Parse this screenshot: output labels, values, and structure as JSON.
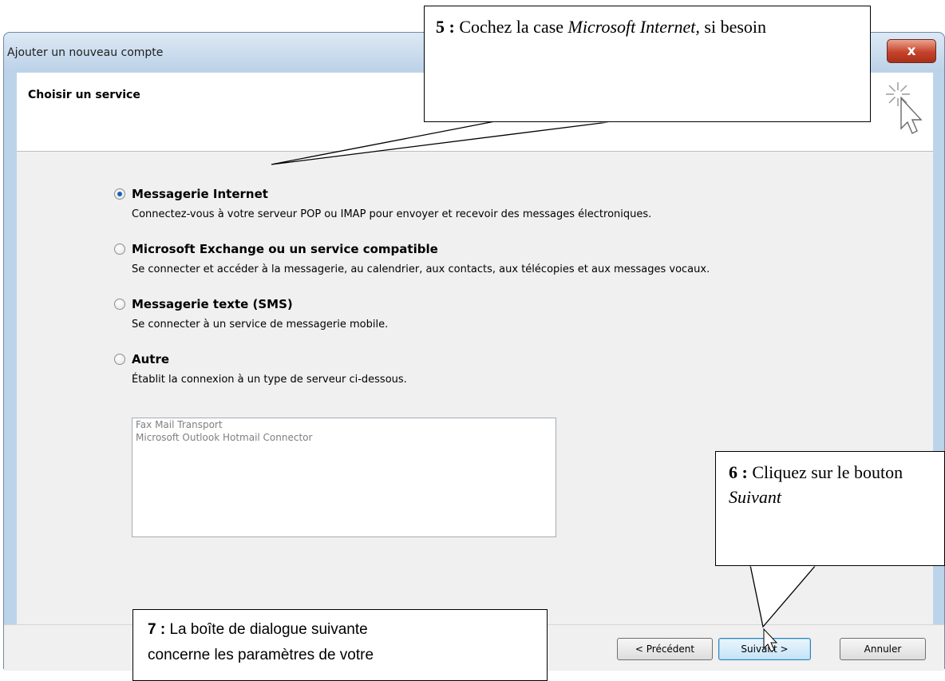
{
  "window": {
    "title": "Ajouter un nouveau compte",
    "close_glyph": "x"
  },
  "header": {
    "title": "Choisir un service",
    "icon": "wizard-cursor-icon"
  },
  "options": [
    {
      "label": "Messagerie Internet",
      "description": "Connectez-vous à votre serveur POP ou IMAP pour envoyer et recevoir des messages électroniques.",
      "checked": true
    },
    {
      "label": "Microsoft Exchange ou un service compatible",
      "description": "Se connecter et accéder à la messagerie, au calendrier, aux contacts, aux télécopies et aux messages vocaux.",
      "checked": false
    },
    {
      "label": "Messagerie texte (SMS)",
      "description": "Se connecter à un service de messagerie mobile.",
      "checked": false
    },
    {
      "label": "Autre",
      "description": "Établit la connexion à un type de serveur ci-dessous.",
      "checked": false
    }
  ],
  "server_list": [
    "Fax Mail Transport",
    "Microsoft Outlook Hotmail Connector"
  ],
  "buttons": {
    "previous": "< Précédent",
    "next": "Suivant >",
    "cancel": "Annuler"
  },
  "callouts": {
    "c5": {
      "number": "5 :",
      "text_before": " Cochez la case ",
      "emphasis": "Microsoft Internet,",
      "text_after": " si besoin"
    },
    "c6": {
      "number": "6 :",
      "text_before": " Cliquez sur le bouton ",
      "emphasis": "Suivant"
    },
    "c7": {
      "number": "7 :",
      "text_line1": " La boîte de dialogue suivante",
      "text_line2": "concerne les paramètres de votre"
    }
  },
  "colors": {
    "window_frame": "#bcd4ea",
    "close_button": "#c6422a",
    "radio_selected": "#1d5fae",
    "default_button": "#c5e3f7"
  }
}
